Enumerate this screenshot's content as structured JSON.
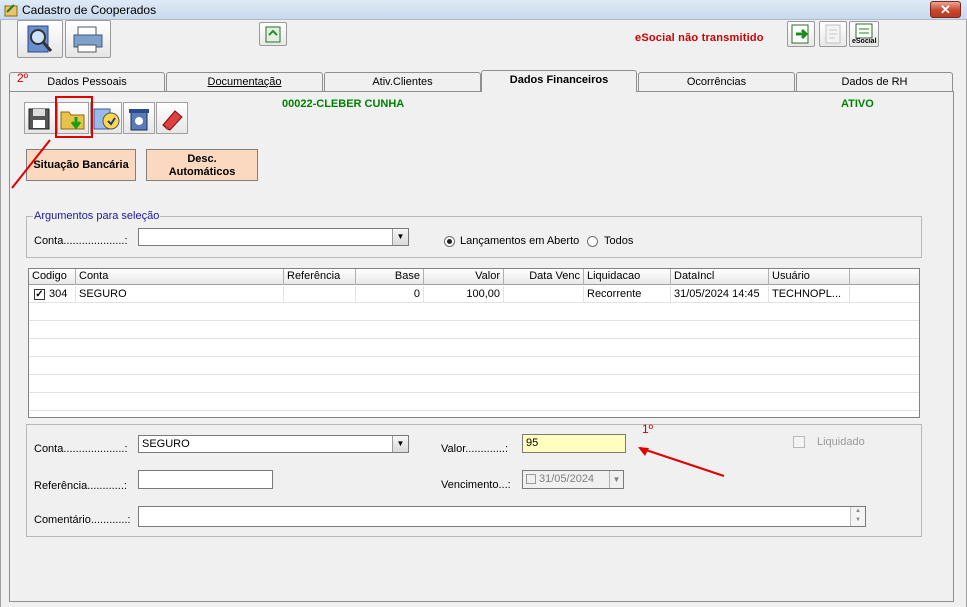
{
  "window": {
    "title": "Cadastro de Cooperados",
    "close_label": "✕"
  },
  "toolbar": {
    "esocial_status": "eSocial não transmitido",
    "esocial_btn_label": "eSocial"
  },
  "tabs": [
    {
      "label": "Dados Pessoais",
      "active": false
    },
    {
      "label": "Documentação",
      "active": false
    },
    {
      "label": "Ativ.Clientes",
      "active": false
    },
    {
      "label": "Dados Financeiros",
      "active": true
    },
    {
      "label": "Ocorrências",
      "active": false
    },
    {
      "label": "Dados de RH",
      "active": false
    }
  ],
  "annotations": {
    "tab_note": "2º",
    "field_note": "1º"
  },
  "cooperado": {
    "name": "00022-CLEBER CUNHA",
    "status": "ATIVO"
  },
  "buttons": {
    "situacao": "Situação Bancária",
    "desc_line1": "Desc.",
    "desc_line2": "Automáticos"
  },
  "args": {
    "legend": "Argumentos para seleção",
    "conta_label": "Conta....................:",
    "conta_value": "",
    "radio_aberto": "Lançamentos em Aberto",
    "radio_todos": "Todos"
  },
  "grid": {
    "columns": [
      "Codigo",
      "Conta",
      "Referência",
      "Base",
      "Valor",
      "Data Venc",
      "Liquidacao",
      "DataIncl",
      "Usuário"
    ],
    "rows": [
      {
        "codigo": "304",
        "conta": "SEGURO",
        "referencia": "",
        "base": "0",
        "valor": "100,00",
        "data_venc": "",
        "liquidacao": "Recorrente",
        "data_incl": "31/05/2024 14:45",
        "usuario": "TECHNOPL...",
        "checked": true
      }
    ]
  },
  "detail": {
    "conta_label": "Conta....................:",
    "conta_value": "SEGURO",
    "valor_label": "Valor.............:",
    "valor_value": "95",
    "liquidado_label": "Liquidado",
    "referencia_label": "Referência............:",
    "referencia_value": "",
    "vencimento_label": "Vencimento...:",
    "vencimento_value": "31/05/2024",
    "comentario_label": "Comentário............:",
    "comentario_value": ""
  },
  "colors": {
    "accent_red": "#d00000",
    "status_green": "#008000",
    "highlight_yellow": "#ffffc0",
    "button_peach": "#fbd9c0"
  }
}
